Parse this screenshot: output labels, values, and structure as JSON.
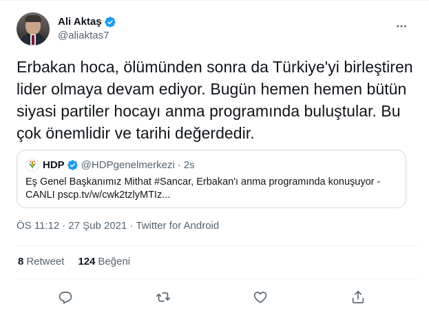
{
  "author": {
    "display_name": "Ali Aktaş",
    "handle": "@aliaktas7"
  },
  "tweet": {
    "text": "Erbakan hoca, ölümünden sonra da Türkiye'yi birleştiren lider olmaya devam ediyor. Bugün hemen hemen bütün siyasi partiler hocayı anma programında buluştular. Bu çok önemlidir ve tarihi değerdedir."
  },
  "quoted": {
    "display_name": "HDP",
    "handle": "@HDPgenelmerkezi",
    "dot": "·",
    "time": "2s",
    "text": "Eş Genel Başkanımız Mithat #Sancar, Erbakan'ı anma programında konuşuyor - CANLI pscp.tv/w/cwk2tzlyMTIz..."
  },
  "meta": {
    "time": "ÖS 11:12",
    "sep": "·",
    "date": "27 Şub 2021",
    "source": "Twitter for Android"
  },
  "stats": {
    "retweet_count": "8",
    "retweet_label": "Retweet",
    "like_count": "124",
    "like_label": "Beğeni"
  },
  "colors": {
    "verified": "#1d9bf0",
    "secondary_text": "#536471",
    "icon": "#536471"
  },
  "icons": [
    "verified-badge-icon",
    "more-options-icon",
    "hdp-logo-icon",
    "reply-icon",
    "retweet-icon",
    "like-icon",
    "share-icon"
  ]
}
